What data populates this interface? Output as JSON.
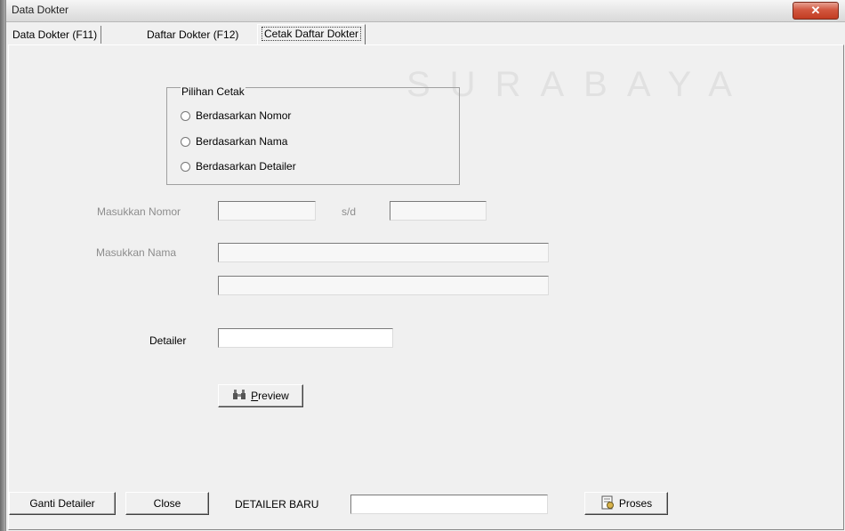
{
  "window": {
    "title": "Data Dokter",
    "close_glyph": "✕",
    "watermark": "SURABAYA"
  },
  "tabs": [
    {
      "label": "Data Dokter (F11)"
    },
    {
      "label": "Daftar Dokter (F12)"
    },
    {
      "label": "Cetak Daftar Dokter",
      "active": true
    }
  ],
  "print_options": {
    "legend": "Pilihan Cetak",
    "options": [
      {
        "label": "Berdasarkan Nomor",
        "selected": false
      },
      {
        "label": "Berdasarkan Nama",
        "selected": false
      },
      {
        "label": "Berdasarkan Detailer",
        "selected": false
      }
    ]
  },
  "form": {
    "nomor_label": "Masukkan Nomor",
    "range_label": "s/d",
    "nomor_from": "",
    "nomor_to": "",
    "nama_label": "Masukkan Nama",
    "nama_from": "",
    "nama_to": "",
    "detailer_label": "Detailer",
    "detailer_value": ""
  },
  "preview_button": {
    "label_first": "P",
    "label_rest": "review",
    "icon": "binoculars-icon"
  },
  "bottom_bar": {
    "ganti_detailer": "Ganti Detailer",
    "close": "Close",
    "detailer_baru_label": "DETAILER BARU",
    "detailer_baru_value": "",
    "proses": "Proses",
    "proses_icon": "process-icon"
  }
}
